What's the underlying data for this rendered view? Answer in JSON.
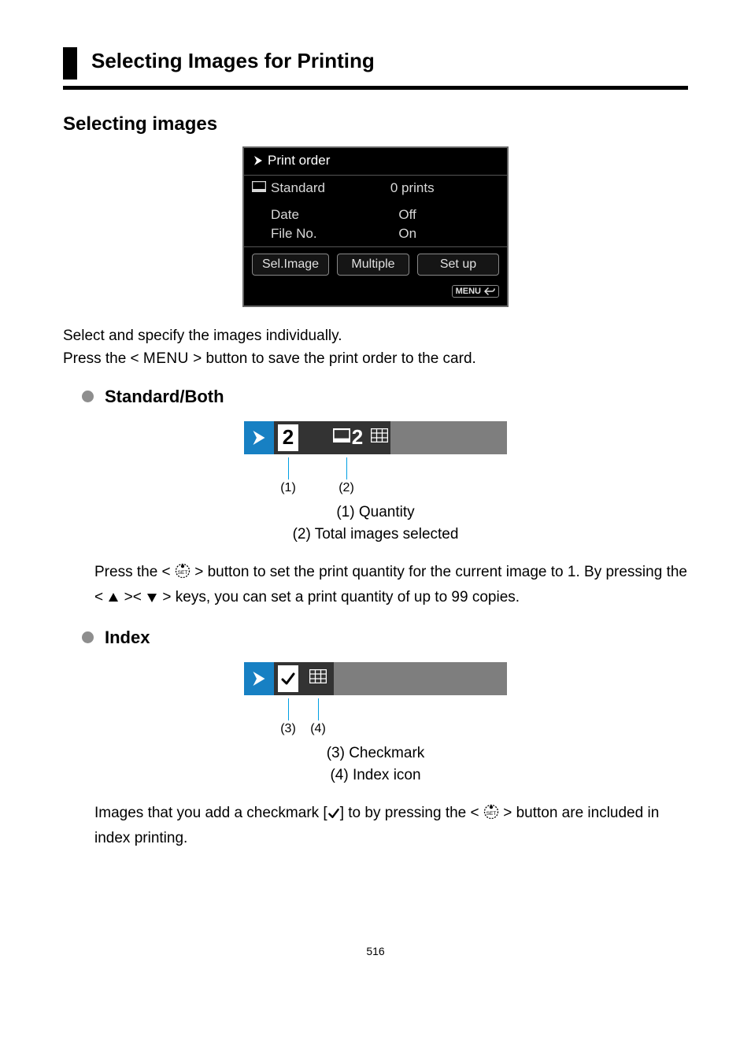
{
  "heading": "Selecting Images for Printing",
  "section_title": "Selecting images",
  "print_order": {
    "title": "Print order",
    "standard_label": "Standard",
    "prints_text": "0 prints",
    "date_label": "Date",
    "date_value": "Off",
    "fileno_label": "File No.",
    "fileno_value": "On",
    "btn_sel": "Sel.Image",
    "btn_multiple": "Multiple",
    "btn_setup": "Set up",
    "menu_text": "MENU"
  },
  "paragraph1_a": "Select and specify the images individually.",
  "paragraph1_b_pre": "Press the < ",
  "paragraph1_b_menu": "MENU",
  "paragraph1_b_post": " > button to save the print order to the card.",
  "sub1_title": "Standard/Both",
  "standard_fig": {
    "quantity_value": "2",
    "total_value": "2"
  },
  "callouts_standard": {
    "n1": "(1)",
    "n2": "(2)"
  },
  "legend_standard": {
    "l1": "(1) Quantity",
    "l2": "(2) Total images selected"
  },
  "paragraph2_pre": "Press the < ",
  "paragraph2_mid": " > button to set the print quantity for the current image to 1. By pressing the < ",
  "paragraph2_mid2": " >< ",
  "paragraph2_post": " > keys, you can set a print quantity of up to 99 copies.",
  "sub2_title": "Index",
  "callouts_index": {
    "n3": "(3)",
    "n4": "(4)"
  },
  "legend_index": {
    "l3": "(3) Checkmark",
    "l4": "(4) Index icon"
  },
  "paragraph3_pre": "Images that you add a checkmark [",
  "paragraph3_mid": "] to by pressing the < ",
  "paragraph3_post": " > button are included in index printing.",
  "page_number": "516"
}
